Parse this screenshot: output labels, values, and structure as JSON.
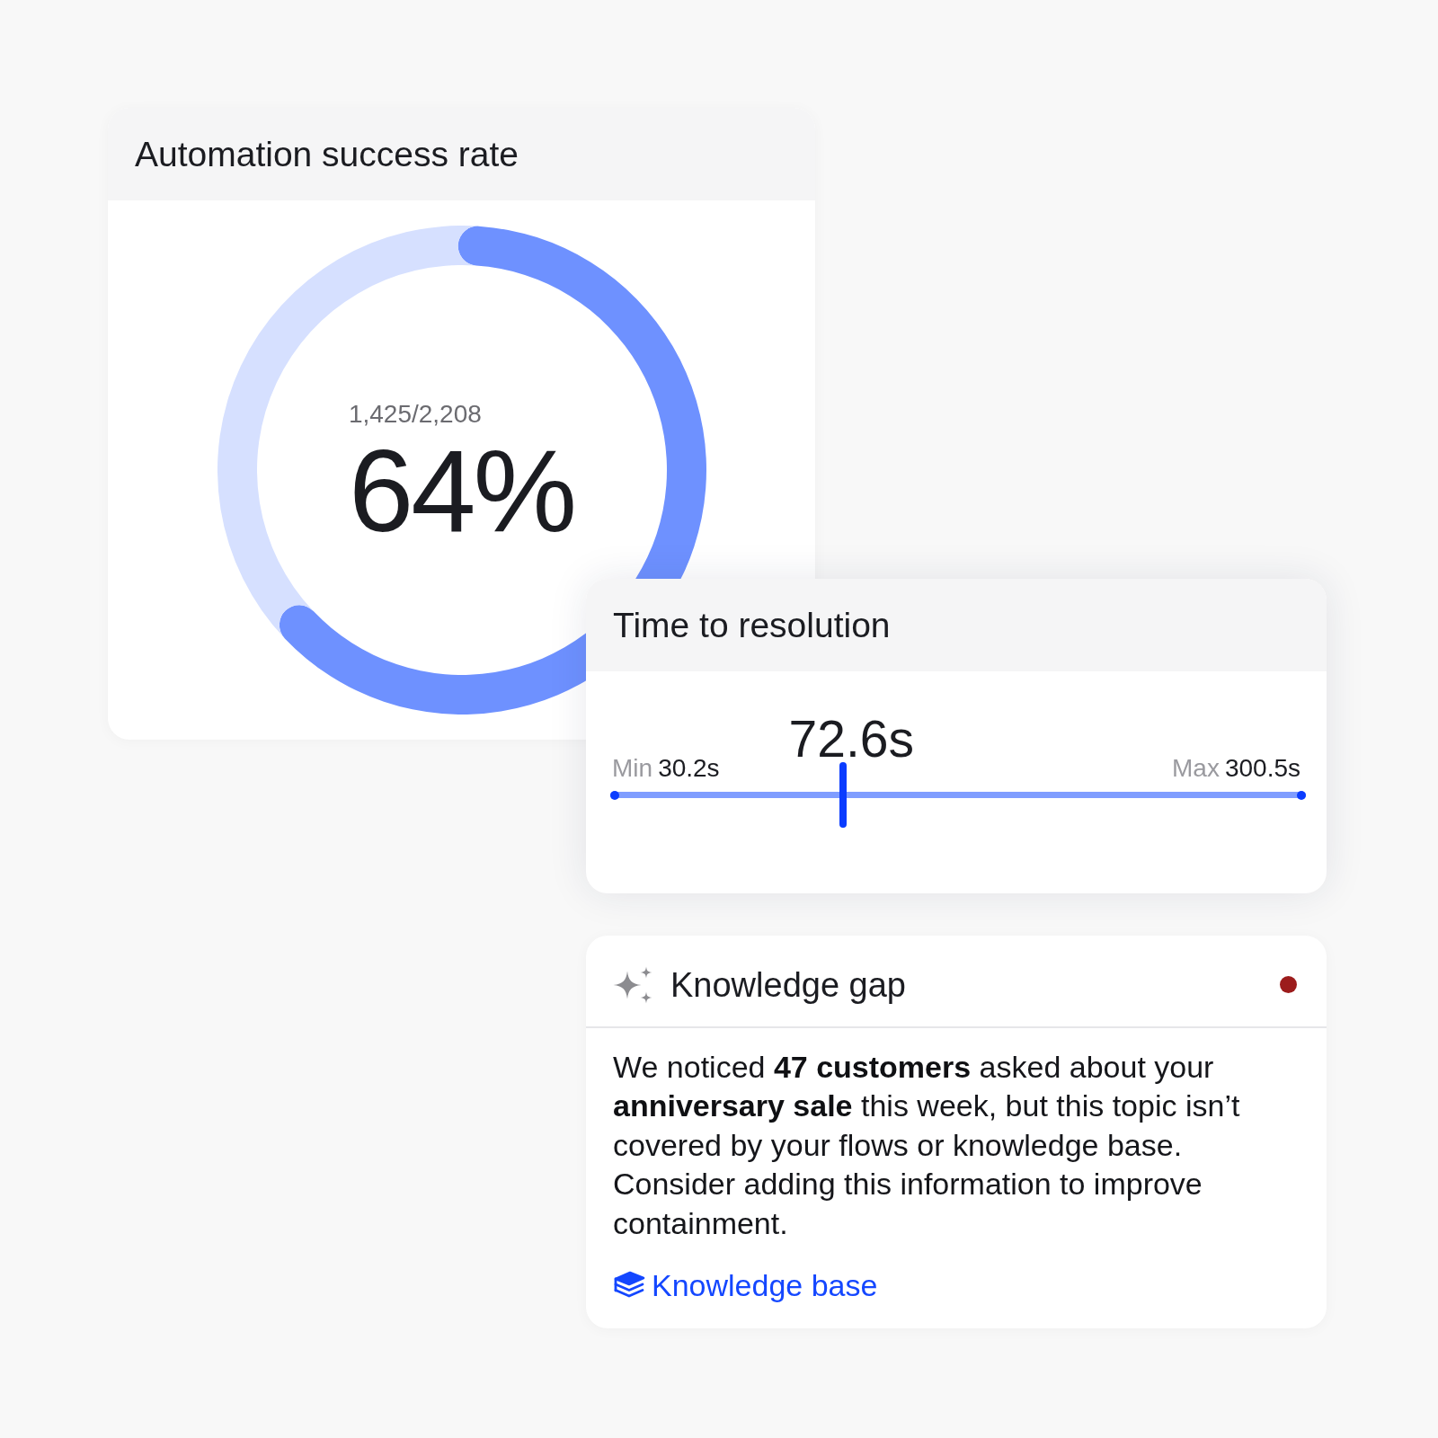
{
  "success_rate": {
    "title": "Automation success rate",
    "count": "1,425/2,208",
    "percent": "64%",
    "chart_data": {
      "type": "donut",
      "values": [
        64,
        36
      ]
    }
  },
  "resolution_time": {
    "title": "Time to resolution",
    "value": "72.6s",
    "min_label": "Min",
    "min": "30.2s",
    "max_label": "Max",
    "max": "300.5s",
    "level": 0.333
  },
  "knowledge_gap": {
    "title": "Knowledge gap",
    "alert": true,
    "message": "We noticed **47 customers** asked about your **anniversary sale** this week, but this topic isn’t covered by your flows or knowledge base. Consider adding this information to improve containment.",
    "link": "Knowledge base"
  }
}
